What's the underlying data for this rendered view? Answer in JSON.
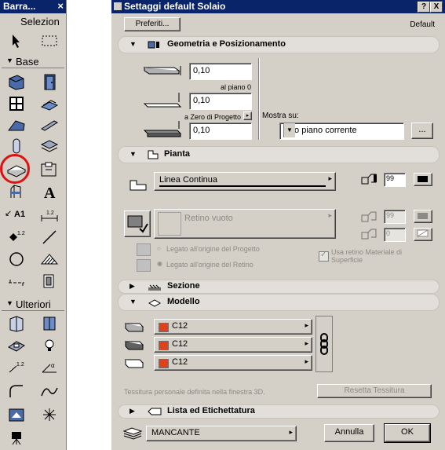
{
  "toolbox": {
    "title": "Barra...",
    "close_glyph": "×",
    "selection_label": "Selezion",
    "sections": {
      "base": "Base",
      "more": "Ulteriori"
    },
    "label_tool_text": "A1",
    "highlight_color": "#e01010"
  },
  "dialog": {
    "title": "Settaggi default Solaio",
    "title_help": "?",
    "title_close": "X",
    "preferiti_button": "Preferiti...",
    "default_label": "Default",
    "sections": {
      "geometry": "Geometria e Posizionamento",
      "plan": "Pianta",
      "section": "Sezione",
      "model": "Modello",
      "listing": "Lista ed Etichettatura"
    },
    "geometry": {
      "thickness_value": "0,10",
      "floor_label": "al piano 0",
      "level_value": "0,10",
      "zero_label": "a Zero di Progetto",
      "offset_value": "0,10",
      "show_on_label": "Mostra su:",
      "show_on_value": "solo piano corrente",
      "dots_button": "..."
    },
    "plan": {
      "line_type": "Linea Continua",
      "pen_value": "99",
      "fill_type": "Retino vuoto",
      "fill_pen": "99",
      "bg_pen": "0",
      "link_project_origin": "Legato all'origine del Progetto",
      "link_fill_origin": "Legato all'origine del Retino",
      "use_material_fill": "Usa retino Materiale di Superficie"
    },
    "model": {
      "top_material": "C12",
      "edge_material": "C12",
      "bottom_material": "C12",
      "texture_note": "Tessitura personale definita nella finestra 3D.",
      "reset_texture": "Resetta Tessitura"
    },
    "footer": {
      "layer_value": "MANCANTE",
      "cancel": "Annulla",
      "ok": "OK"
    }
  }
}
